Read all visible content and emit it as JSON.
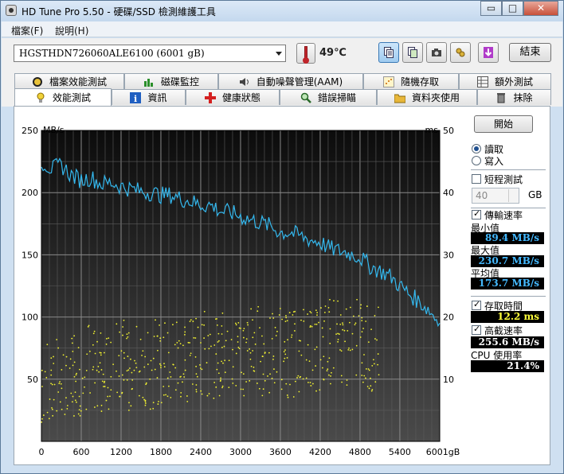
{
  "window": {
    "title": "HD Tune Pro 5.50 - 硬碟/SSD 檢測維護工具",
    "min": "▭",
    "max": "□",
    "close": "✕"
  },
  "menu": [
    "檔案(F)",
    "說明(H)"
  ],
  "toolbar": {
    "drive": "HGSTHDN726060ALE6100 (6001 gB)",
    "temperature": "49℃",
    "exit_label": "結束"
  },
  "tabs_row1": [
    "檔案效能測試",
    "磁碟監控",
    "自動噪聲管理(AAM)",
    "隨機存取",
    "額外測試"
  ],
  "tabs_row2": [
    "效能測試",
    "資訊",
    "健康狀態",
    "錯誤掃瞄",
    "資料夾使用",
    "抹除"
  ],
  "panel": {
    "start": "開始",
    "read": "讀取",
    "write": "寫入",
    "short_test": "短程測試",
    "size_value": "40",
    "size_unit": "GB",
    "transfer_rate": "傳輸速率",
    "min_label": "最小值",
    "min_value": "89.4 MB/s",
    "max_label": "最大值",
    "max_value": "230.7 MB/s",
    "avg_label": "平均值",
    "avg_value": "173.7 MB/s",
    "access_time": "存取時間",
    "access_value": "12.2 ms",
    "burst_rate": "高截速率",
    "burst_value": "255.6 MB/s",
    "cpu_label": "CPU 使用率",
    "cpu_value": "21.4%"
  },
  "chart_data": {
    "type": "line",
    "left_unit": "MB/s",
    "right_unit": "ms",
    "x_unit": "gB",
    "x_ticks": [
      "0",
      "600",
      "1200",
      "1800",
      "2400",
      "3000",
      "3600",
      "4200",
      "4800",
      "5400",
      "6001"
    ],
    "x_range": [
      0,
      6001
    ],
    "y_left_ticks": [
      "50",
      "100",
      "150",
      "200",
      "250"
    ],
    "y_left_range": [
      0,
      250
    ],
    "y_right_ticks": [
      "10",
      "20",
      "30",
      "40",
      "50"
    ],
    "y_right_range": [
      0,
      50
    ],
    "grid": true,
    "series": [
      {
        "color": "#34b8ee",
        "axis": "left",
        "x": [
          0,
          150,
          300,
          450,
          600,
          750,
          900,
          1050,
          1200,
          1350,
          1500,
          1650,
          1800,
          1950,
          2100,
          2250,
          2400,
          2550,
          2700,
          2850,
          3000,
          3150,
          3300,
          3450,
          3600,
          3750,
          3900,
          4050,
          4200,
          4350,
          4500,
          4650,
          4800,
          4950,
          5100,
          5250,
          5400,
          5550,
          5700,
          5850,
          6001
        ],
        "y": [
          225,
          219,
          222,
          214,
          210,
          212,
          207,
          208,
          205,
          203,
          201,
          200,
          198,
          198,
          195,
          193,
          190,
          190,
          185,
          184,
          181,
          178,
          176,
          173,
          168,
          168,
          165,
          162,
          160,
          155,
          153,
          151,
          148,
          141,
          137,
          133,
          125,
          118,
          112,
          105,
          95
        ]
      },
      {
        "color": "#f2f230",
        "axis": "right",
        "kind": "scatter",
        "x": [
          0,
          200,
          400,
          600,
          800,
          1000,
          1200,
          1400,
          1600,
          1800,
          2000,
          2200,
          2400,
          2600,
          2800,
          3000,
          3200,
          3400,
          3600,
          3800,
          4000,
          4200,
          4400,
          4600,
          4800,
          5000
        ],
        "y": [
          9,
          10,
          11,
          11,
          12,
          11,
          13,
          12,
          12,
          13,
          14,
          13,
          14,
          13,
          14,
          14,
          15,
          14,
          15,
          14,
          15,
          15,
          16,
          15,
          16,
          15
        ]
      }
    ]
  }
}
